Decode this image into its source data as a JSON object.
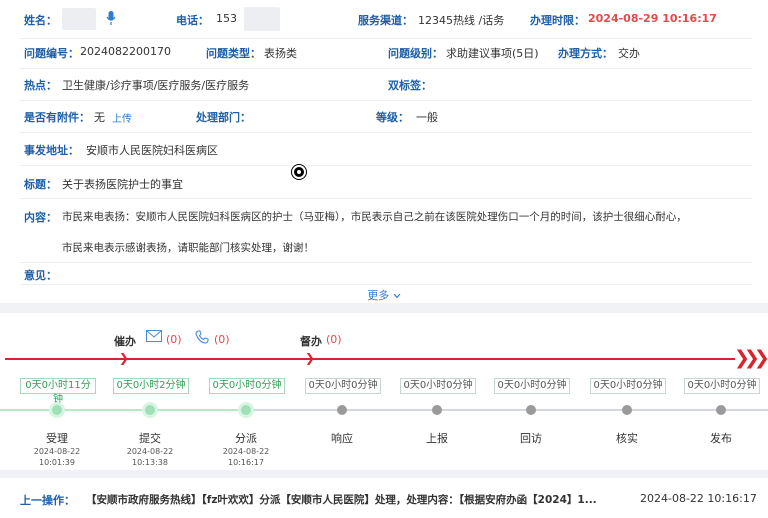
{
  "header": {
    "name_label": "姓名：",
    "name_value": "",
    "phone_label": "电话：",
    "phone_value": "153",
    "channel_label": "服务渠道：",
    "channel_value": "12345热线 /话务",
    "deadline_label": "办理时限：",
    "deadline_value": "2024-08-29 10:16:17"
  },
  "fields": {
    "issue_no_label": "问题编号：",
    "issue_no_value": "2024082200170",
    "issue_type_label": "问题类型：",
    "issue_type_value": "表扬类",
    "issue_level_label": "问题级别：",
    "issue_level_value": "求助建议事项(5日)",
    "handle_mode_label": "办理方式：",
    "handle_mode_value": "交办",
    "hotspot_label": "热点：",
    "hotspot_value": "卫生健康/诊疗事项/医疗服务/医疗服务",
    "double_tag_label": "双标签：",
    "double_tag_value": "",
    "attachment_label": "是否有附件：",
    "attachment_value": "无",
    "upload_link": "上传",
    "dept_label": "处理部门：",
    "dept_value": "",
    "grade_label": "等级：",
    "grade_value": "一般",
    "address_label": "事发地址：",
    "address_value": "安顺市人民医院妇科医病区",
    "title_label": "标题：",
    "title_value": "关于表扬医院护士的事宜",
    "content_label": "内容：",
    "content_line1": "市民来电表扬：安顺市人民医院妇科医病区的护士（马亚梅），市民表示自己之前在该医院处理伤口一个月的时间，该护士很细心耐心，",
    "content_line2": "市民来电表示感谢表扬，请职能部门核实处理，谢谢！",
    "opinion_label": "意见：",
    "opinion_value": ""
  },
  "more_label": "更多",
  "flow": {
    "urge_label": "催办",
    "urge_mail_count": "(0)",
    "urge_phone_count": "(0)",
    "supervise_label": "督办",
    "supervise_count": "(0)",
    "stages": [
      {
        "name": "受理",
        "duration": "0天0小时11分钟",
        "time": "2024-08-22 10:01:39",
        "done": true
      },
      {
        "name": "提交",
        "duration": "0天0小时2分钟",
        "time": "2024-08-22 10:13:38",
        "done": true
      },
      {
        "name": "分派",
        "duration": "0天0小时0分钟",
        "time": "2024-08-22 10:16:17",
        "done": true
      },
      {
        "name": "响应",
        "duration": "0天0小时0分钟",
        "time": "",
        "done": false
      },
      {
        "name": "上报",
        "duration": "0天0小时0分钟",
        "time": "",
        "done": false
      },
      {
        "name": "回访",
        "duration": "0天0小时0分钟",
        "time": "",
        "done": false
      },
      {
        "name": "核实",
        "duration": "0天0小时0分钟",
        "time": "",
        "done": false
      },
      {
        "name": "发布",
        "duration": "0天0小时0分钟",
        "time": "",
        "done": false
      }
    ]
  },
  "last_op": {
    "label": "上一操作：",
    "text": "【安顺市政府服务热线】【fz叶欢欢】分派【安顺市人民医院】处理，处理内容：【根据安府办函【2024】1...",
    "time": "2024-08-22 10:16:17"
  },
  "colors": {
    "accent": "#1f5fa8",
    "warning": "#e04b4b",
    "flow_red": "#d9232d",
    "done_green": "#9fe0b6"
  },
  "icons": [
    "mic-icon",
    "mail-icon",
    "phone-icon",
    "chevron-down-icon",
    "triple-chevron-icon",
    "cursor-icon"
  ]
}
